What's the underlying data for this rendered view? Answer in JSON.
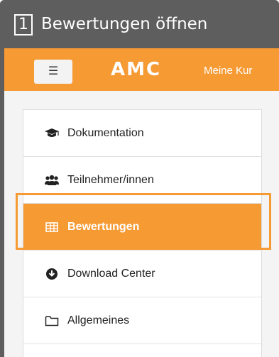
{
  "step": {
    "number": "1",
    "title": "Bewertungen öffnen"
  },
  "topbar": {
    "menu_icon": "hamburger-icon",
    "logo_text": "AMC",
    "nav_link": "Meine Kur"
  },
  "sidebar": {
    "items": [
      {
        "label": "Dokumentation",
        "icon": "graduation-cap-icon",
        "active": false
      },
      {
        "label": "Teilnehmer/innen",
        "icon": "users-icon",
        "active": false
      },
      {
        "label": "Bewertungen",
        "icon": "table-icon",
        "active": true
      },
      {
        "label": "Download Center",
        "icon": "download-circle-icon",
        "active": false
      },
      {
        "label": "Allgemeines",
        "icon": "folder-icon",
        "active": false
      }
    ]
  },
  "colors": {
    "accent": "#f69a34",
    "header_bg": "#5e5e5e"
  }
}
